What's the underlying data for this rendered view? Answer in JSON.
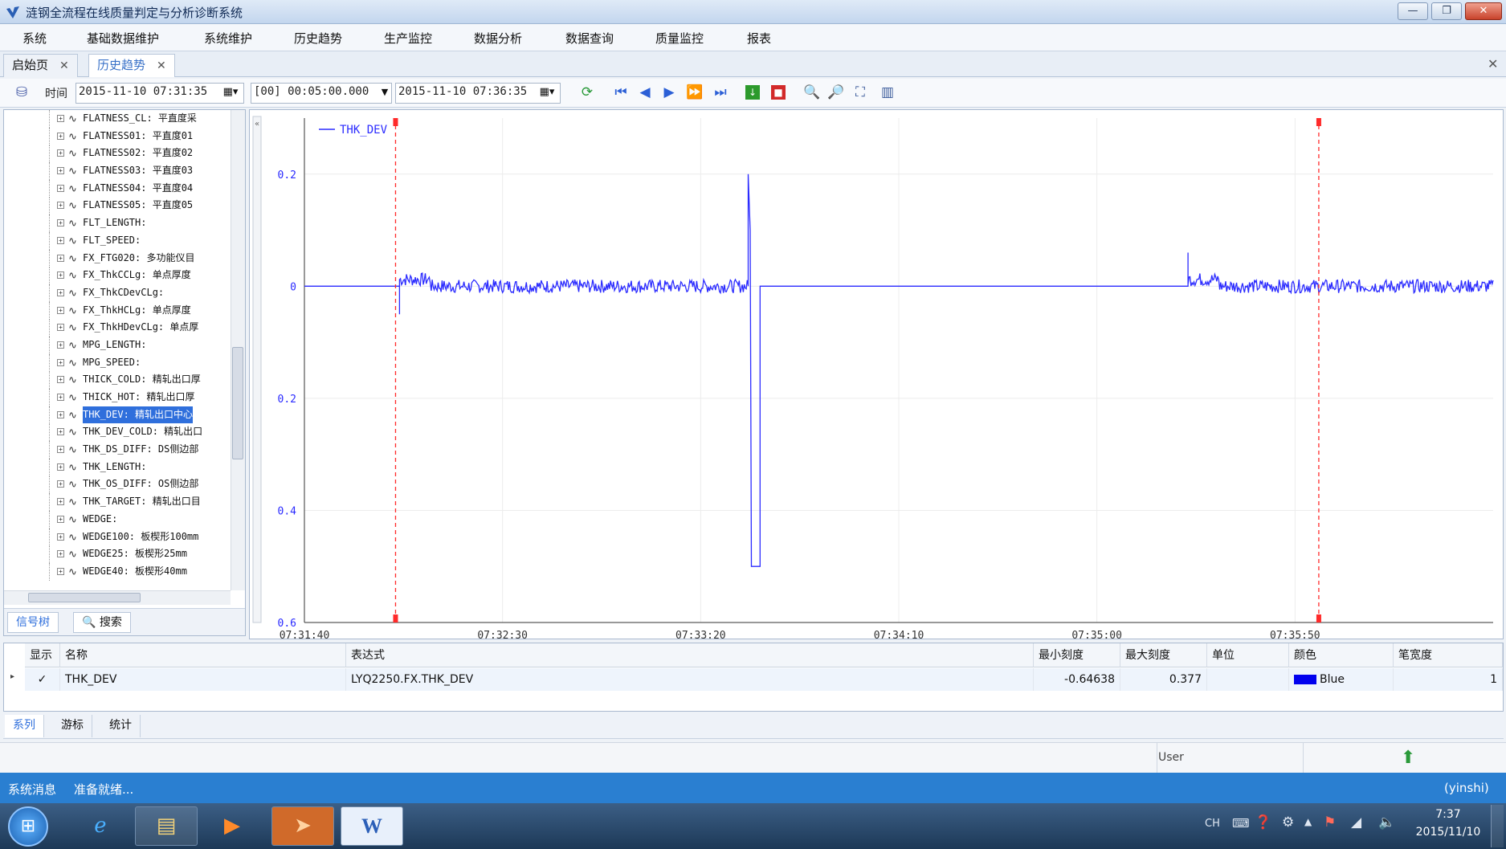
{
  "window": {
    "title": "涟钢全流程在线质量判定与分析诊断系统"
  },
  "menu": [
    "系统",
    "基础数据维护",
    "系统维护",
    "历史趋势",
    "生产监控",
    "数据分析",
    "数据查询",
    "质量监控",
    "报表"
  ],
  "tabs": [
    {
      "label": "启始页"
    },
    {
      "label": "历史趋势"
    }
  ],
  "toolbar": {
    "time_label": "时间",
    "start_time": "2015-11-10 07:31:35",
    "duration": "[00] 00:05:00.000",
    "end_time": "2015-11-10 07:36:35"
  },
  "tree": [
    "FLATNESS_CL: 平直度采",
    "FLATNESS01: 平直度01",
    "FLATNESS02: 平直度02",
    "FLATNESS03: 平直度03",
    "FLATNESS04: 平直度04",
    "FLATNESS05: 平直度05",
    "FLT_LENGTH:",
    "FLT_SPEED:",
    "FX_FTG020: 多功能仪目",
    "FX_ThkCCLg: 单点厚度",
    "FX_ThkCDevCLg:",
    "FX_ThkHCLg: 单点厚度",
    "FX_ThkHDevCLg: 单点厚",
    "MPG_LENGTH:",
    "MPG_SPEED:",
    "THICK_COLD: 精轧出口厚",
    "THICK_HOT: 精轧出口厚",
    "THK_DEV: 精轧出口中心",
    "THK_DEV_COLD: 精轧出口",
    "THK_DS_DIFF: DS侧边部",
    "THK_LENGTH:",
    "THK_OS_DIFF: OS侧边部",
    "THK_TARGET: 精轧出口目",
    "WEDGE:",
    "WEDGE100: 板楔形100mm",
    "WEDGE25: 板楔形25mm",
    "WEDGE40: 板楔形40mm"
  ],
  "left_buttons": {
    "signal_tree": "信号树",
    "search": "搜索"
  },
  "chart_data": {
    "type": "line",
    "series": [
      {
        "name": "THK_DEV",
        "color": "#2b2bff"
      }
    ],
    "ylim": [
      -0.6,
      0.3
    ],
    "y_ticks": [
      "0.2",
      "0",
      "0.2",
      "0.4",
      "0.6"
    ],
    "y_tick_values": [
      0.2,
      0,
      -0.2,
      -0.4,
      -0.6
    ],
    "x_ticks": [
      "07:31:40",
      "07:32:30",
      "07:33:20",
      "07:34:10",
      "07:35:00",
      "07:35:50"
    ],
    "x_tick_seconds": [
      0,
      50,
      100,
      150,
      200,
      250
    ],
    "x_range_seconds": [
      0,
      300
    ],
    "cursor_lines_seconds": [
      23,
      256
    ],
    "segments": [
      {
        "x0": 0,
        "x1": 24,
        "y": 0,
        "noise": 0
      },
      {
        "x0": 24,
        "x1": 112,
        "y": 0,
        "noise": 0.012,
        "start_spike": -0.05
      },
      {
        "x0": 112,
        "x1": 112.5,
        "spike": 0.2
      },
      {
        "x0": 113,
        "x1": 115,
        "y": -0.5,
        "noise": 0
      },
      {
        "x0": 115,
        "x1": 223,
        "y": 0,
        "noise": 0
      },
      {
        "x0": 223,
        "x1": 300,
        "y": 0,
        "noise": 0.012,
        "start_spike": 0.06
      }
    ]
  },
  "grid": {
    "headers": [
      "显示",
      "名称",
      "表达式",
      "最小刻度",
      "最大刻度",
      "单位",
      "颜色",
      "笔宽度"
    ],
    "row": {
      "check": "✓",
      "name": "THK_DEV",
      "expr": "LYQ2250.FX.THK_DEV",
      "min": "-0.64638",
      "max": "0.377",
      "unit": "",
      "color_name": "Blue",
      "color": "#0000ee",
      "width": "1"
    }
  },
  "bottom_tabs": [
    "系列",
    "游标",
    "统计"
  ],
  "status": {
    "user": "User"
  },
  "message": {
    "label": "系统消息",
    "text": "准备就绪...",
    "right": "(yinshi)"
  },
  "clock": {
    "time": "7:37",
    "date": "2015/11/10",
    "lang": "CH"
  }
}
